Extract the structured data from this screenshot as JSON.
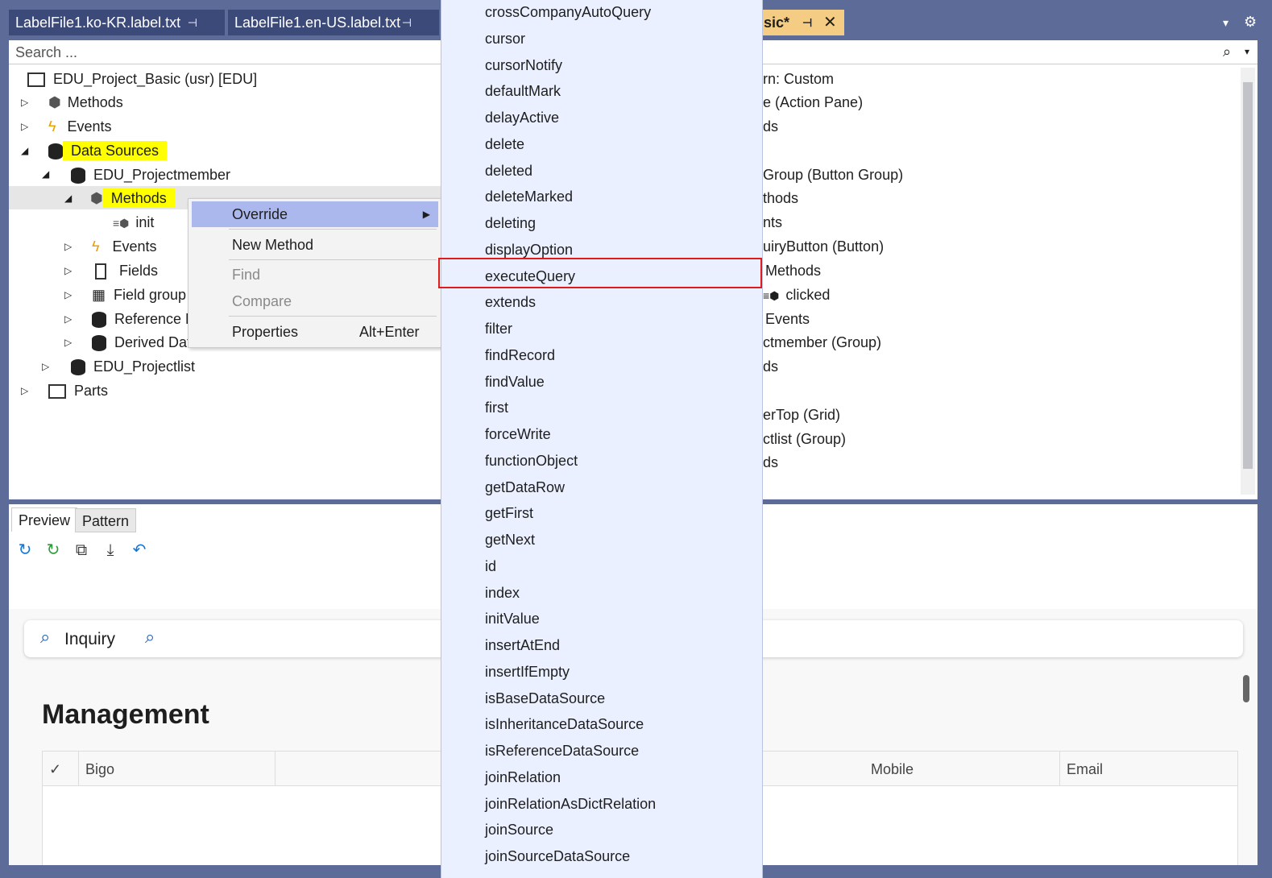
{
  "tabs": [
    {
      "label": "LabelFile1.ko-KR.label.txt"
    },
    {
      "label": "LabelFile1.en-US.label.txt"
    },
    {
      "label": "sic*"
    }
  ],
  "search": {
    "placeholder": "Search ..."
  },
  "tree": {
    "root": "EDU_Project_Basic (usr) [EDU]",
    "methods": "Methods",
    "events": "Events",
    "data_sources": "Data Sources",
    "projectmember": "EDU_Projectmember",
    "ds_methods": "Methods",
    "init": "init",
    "ds_events": "Events",
    "fields": "Fields",
    "field_groups": "Field group",
    "reference": "Reference D",
    "derived": "Derived Data Sources",
    "projectlist": "EDU_Projectlist",
    "parts": "Parts"
  },
  "context_menu": {
    "override": "Override",
    "new_method": "New Method",
    "find": "Find",
    "compare": "Compare",
    "properties": "Properties",
    "properties_shortcut": "Alt+Enter"
  },
  "override_list": [
    "crossCompanyAutoQuery",
    "cursor",
    "cursorNotify",
    "defaultMark",
    "delayActive",
    "delete",
    "deleted",
    "deleteMarked",
    "deleting",
    "displayOption",
    "executeQuery",
    "extends",
    "filter",
    "findRecord",
    "findValue",
    "first",
    "forceWrite",
    "functionObject",
    "getDataRow",
    "getFirst",
    "getNext",
    "id",
    "index",
    "initValue",
    "insertAtEnd",
    "insertIfEmpty",
    "isBaseDataSource",
    "isInheritanceDataSource",
    "isReferenceDataSource",
    "joinRelation",
    "joinRelationAsDictRelation",
    "joinSource",
    "joinSourceDataSource"
  ],
  "right_tree": [
    "rn: Custom",
    "e (Action Pane)",
    "ds",
    "",
    "Group (Button Group)",
    "thods",
    "nts",
    "uiryButton (Button)",
    "Methods",
    "clicked",
    "Events",
    "ctmember (Group)",
    "ds",
    "",
    "erTop (Grid)",
    "ctlist (Group)",
    "ds"
  ],
  "preview": {
    "tab_preview": "Preview",
    "tab_pattern": "Pattern",
    "inquiry": "Inquiry",
    "heading": "Management",
    "col_bigo": "Bigo",
    "col_mobile": "Mobile",
    "col_email": "Email"
  }
}
